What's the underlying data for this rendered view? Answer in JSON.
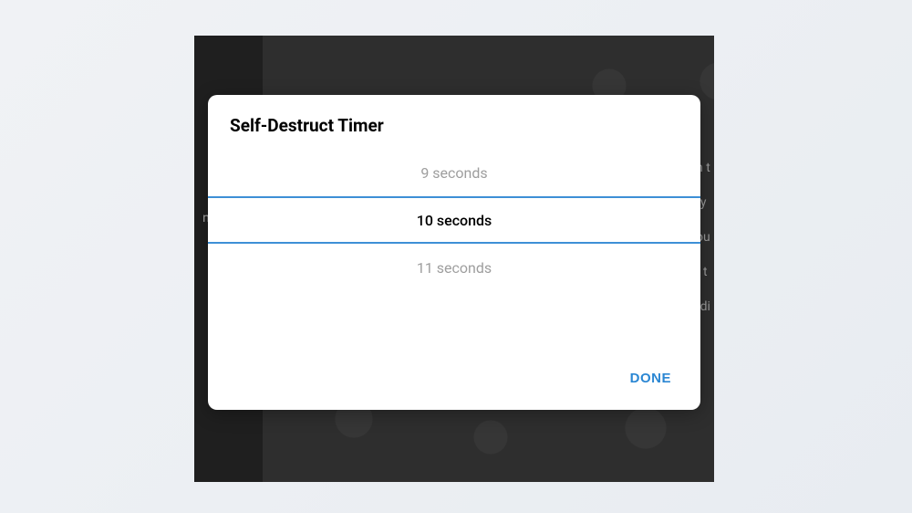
{
  "dialog": {
    "title": "Self-Destruct Timer",
    "options": {
      "prev": "9 seconds",
      "selected": "10 seconds",
      "next": "11 seconds"
    },
    "done_label": "DONE"
  },
  "bg": {
    "left_fragment": "n a",
    "right_lines": [
      "n t",
      " ",
      "ry",
      "ou",
      "t t",
      "rdi"
    ]
  }
}
